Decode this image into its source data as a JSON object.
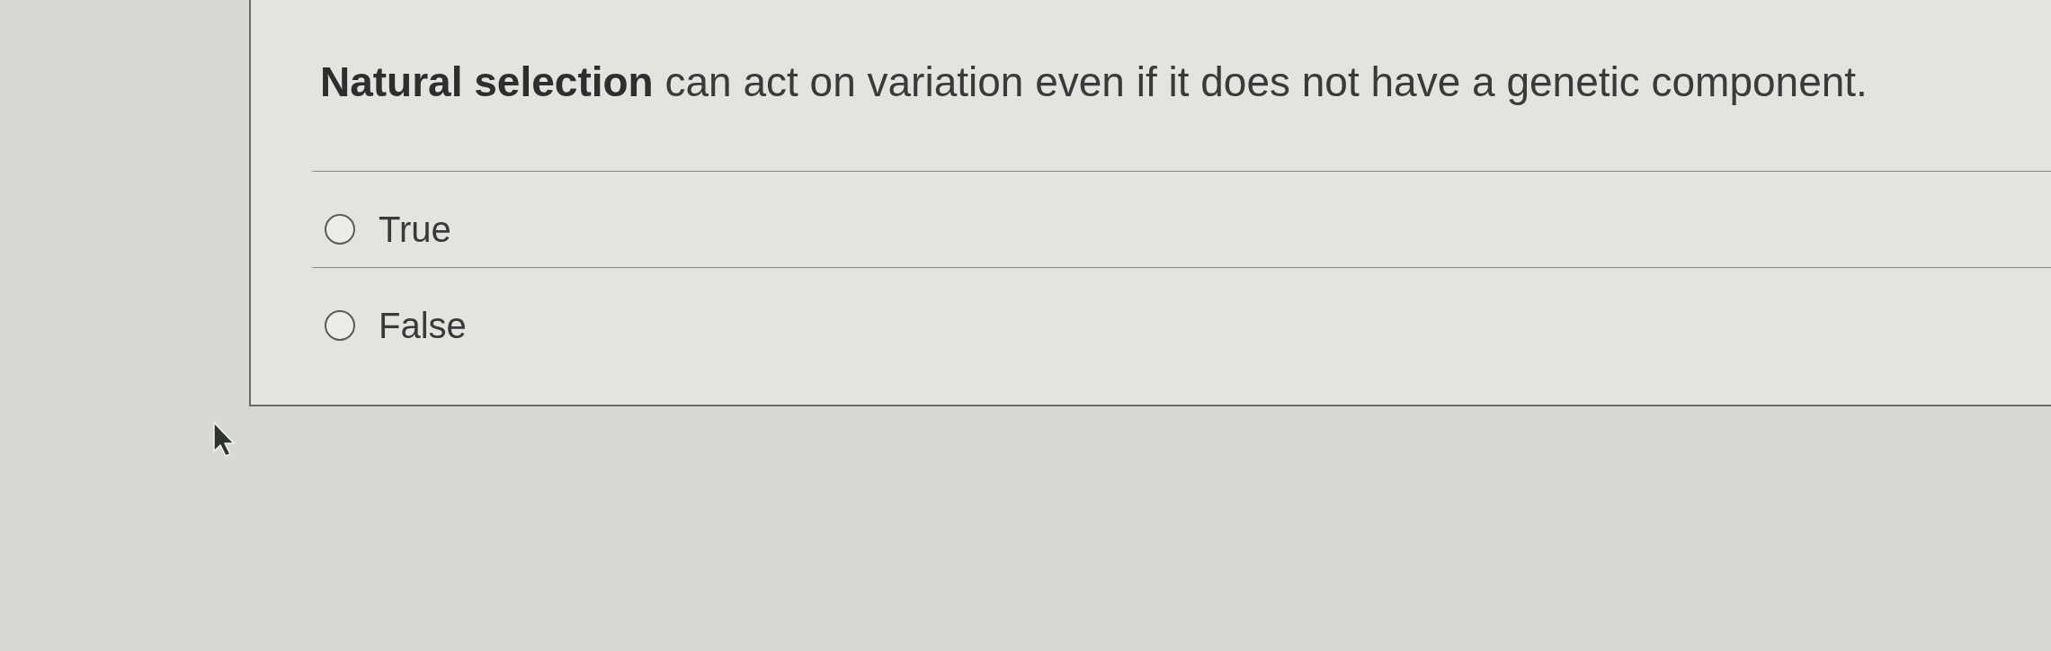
{
  "question": {
    "text": "**Natural selection** can act on variation even if it does not have a genetic component."
  },
  "options": [
    {
      "label": "True",
      "selected": false
    },
    {
      "label": "False",
      "selected": false
    }
  ]
}
